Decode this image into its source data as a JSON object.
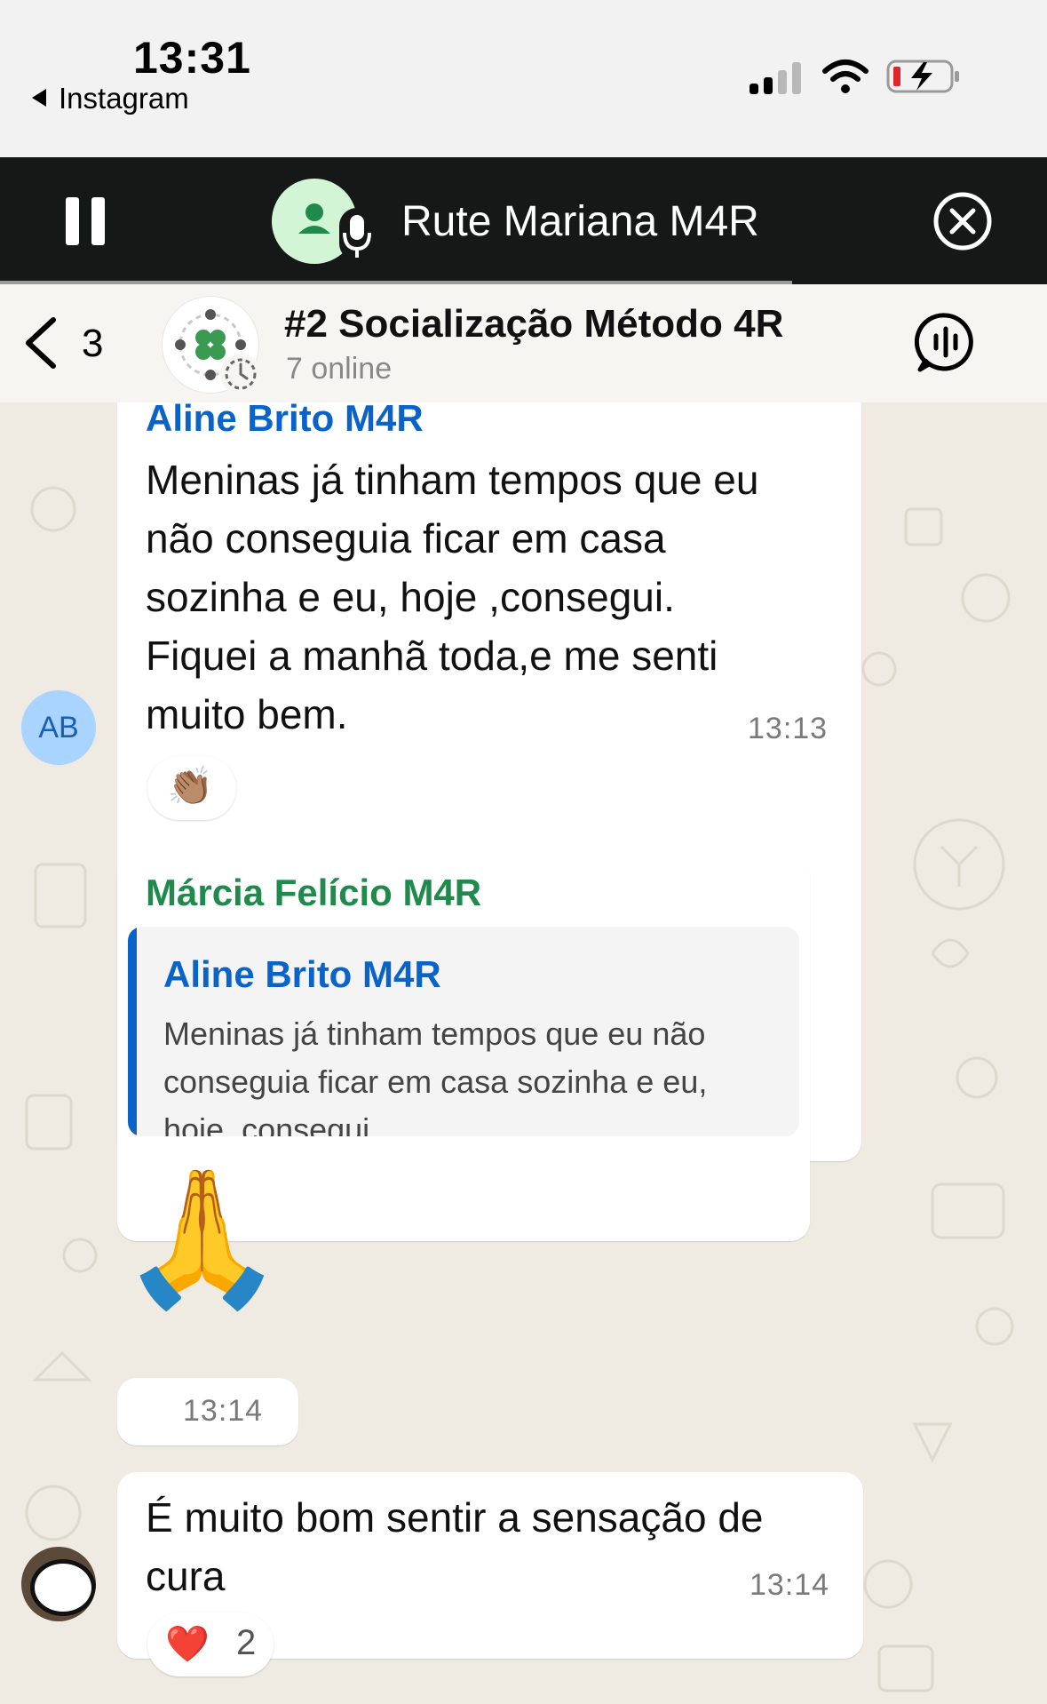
{
  "status_bar": {
    "time": "13:31",
    "back_app": "Instagram"
  },
  "call_banner": {
    "name": "Rute Mariana M4R"
  },
  "header": {
    "back_count": "3",
    "group_name": "#2 Socialização Método 4R",
    "subtitle": "7 online"
  },
  "messages": [
    {
      "sender": "Aline Brito M4R",
      "avatar_initials": "AB",
      "text_lines": [
        "Meninas já tinham tempos que eu",
        "não conseguia ficar em casa",
        "sozinha e eu, hoje ,consegui.",
        "Fiquei a manhã toda,e me senti",
        "muito bem."
      ],
      "time": "13:13",
      "reaction": "👏🏽"
    },
    {
      "sender": "Márcia Felício M4R",
      "quote_sender": "Aline Brito M4R",
      "quote_lines": [
        "Meninas já tinham tempos que eu não",
        "conseguia ficar em casa sozinha e eu,",
        "hoje ,consegui."
      ],
      "emoji": "🙏",
      "time": "13:14"
    },
    {
      "text_lines": [
        "É muito bom sentir a sensação de",
        "cura"
      ],
      "time": "13:14",
      "reaction_emoji": "❤️",
      "reaction_count": "2"
    }
  ],
  "colors": {
    "aline_name": "#0a63c9",
    "marcia_name": "#1f8a4c",
    "call_bar": "#161818",
    "chat_bg": "#efeae2"
  },
  "icons": [
    "pause-icon",
    "person-icon",
    "mic-icon",
    "close-circle-icon",
    "chevron-left-icon",
    "timer-icon",
    "voice-chat-icon",
    "signal-icon",
    "wifi-icon",
    "battery-charging-icon"
  ]
}
